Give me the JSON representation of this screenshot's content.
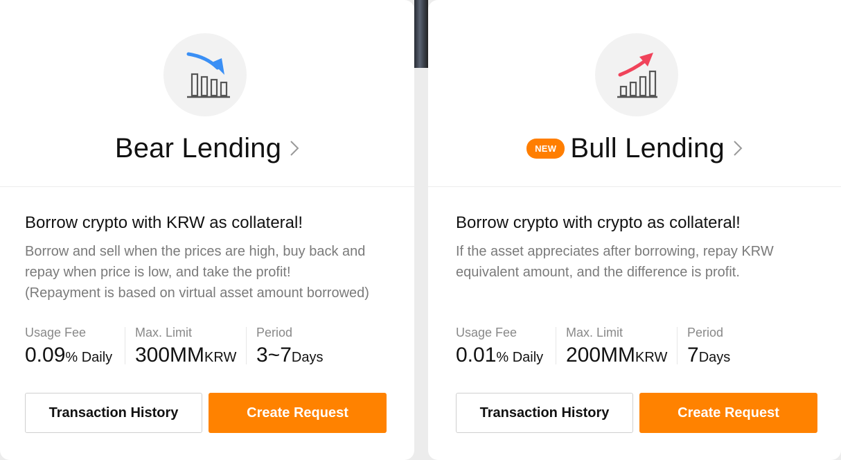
{
  "colors": {
    "accent": "#ff8200",
    "bear_arrow": "#3a8ff5",
    "bull_arrow": "#f0435a"
  },
  "cards": [
    {
      "icon": "bear-chart-icon",
      "title": "Bear Lending",
      "badge": "",
      "subtitle": "Borrow crypto with KRW as collateral!",
      "description": "Borrow and sell when the prices are high, buy back and\nrepay when price is low, and take the profit!\n(Repayment is based on virtual asset amount borrowed)",
      "stats": [
        {
          "label": "Usage Fee",
          "value": "0.09",
          "unit": "% Daily"
        },
        {
          "label": "Max. Limit",
          "value": "300MM",
          "unit": "KRW"
        },
        {
          "label": "Period",
          "value": "3~7",
          "unit": "Days"
        }
      ],
      "history_label": "Transaction History",
      "request_label": "Create Request"
    },
    {
      "icon": "bull-chart-icon",
      "title": "Bull Lending",
      "badge": "NEW",
      "subtitle": "Borrow crypto with crypto as collateral!",
      "description": "If the asset appreciates after borrowing, repay KRW\nequivalent amount, and the difference is profit.",
      "stats": [
        {
          "label": "Usage Fee",
          "value": "0.01",
          "unit": "% Daily"
        },
        {
          "label": "Max. Limit",
          "value": "200MM",
          "unit": "KRW"
        },
        {
          "label": "Period",
          "value": "7",
          "unit": "Days"
        }
      ],
      "history_label": "Transaction History",
      "request_label": "Create Request"
    }
  ]
}
